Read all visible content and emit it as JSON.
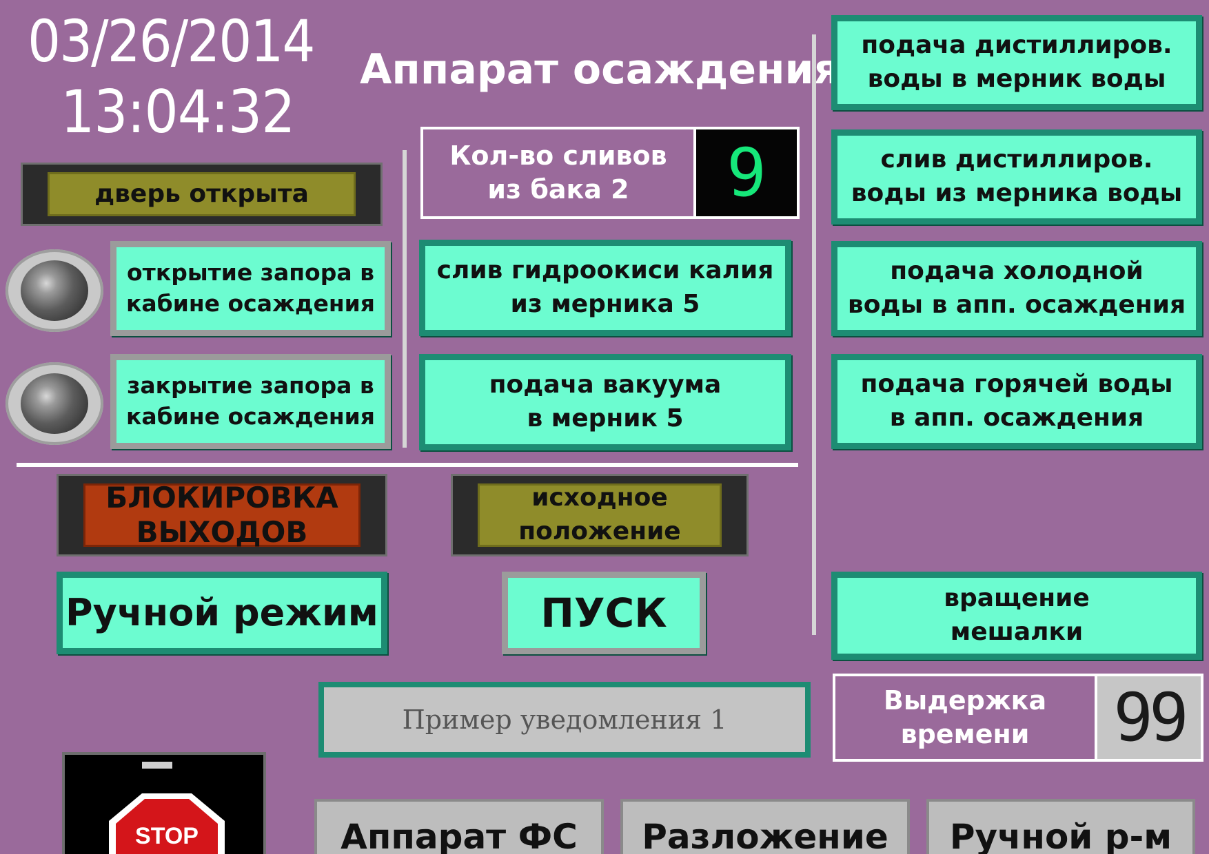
{
  "header": {
    "date": "03/26/2014",
    "time": "13:04:32",
    "title": "Аппарат осаждения"
  },
  "status": {
    "door": "дверь открыта",
    "lock": "БЛОКИРОВКА\nВЫХОДОВ",
    "home": "исходное\nположение"
  },
  "left_buttons": {
    "open_lock": "открытие запора в\nкабине осаждения",
    "close_lock": "закрытие запора в\nкабине осаждения"
  },
  "counters": {
    "drains_label": "Кол-во сливов\nиз бака 2",
    "drains_value": "9",
    "delay_label": "Выдержка\nвремени",
    "delay_value": "99"
  },
  "center_buttons": {
    "drain_koh": "слив гидроокиси калия\nиз мерника 5",
    "vacuum": "подача вакуума\nв мерник 5"
  },
  "right_buttons": {
    "feed_distilled": "подача дистиллиров.\nводы в мерник воды",
    "drain_distilled": "слив дистиллиров.\nводы из мерника воды",
    "feed_cold": "подача холодной\nводы в апп. осаждения",
    "feed_hot": "подача горячей воды\nв апп. осаждения",
    "stirrer": "вращение\nмешалки"
  },
  "controls": {
    "manual_mode": "Ручной режим",
    "start": "ПУСК"
  },
  "notification": "Пример уведомления 1",
  "stop_label": "STOP",
  "nav": {
    "tab1": "Аппарат ФС",
    "tab2": "Разложение",
    "tab3": "Ручной р-м"
  },
  "colors": {
    "background": "#9a6a9b",
    "button_face": "#6cfcd0",
    "button_border": "#1d8c73",
    "lamp_olive": "#8f8c2a",
    "lamp_red": "#b13a10",
    "digit_green": "#16e87a"
  }
}
